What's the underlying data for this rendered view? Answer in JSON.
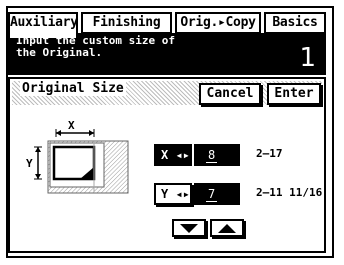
{
  "tabs": [
    {
      "label": "Auxiliary",
      "active": true
    },
    {
      "label": "Finishing",
      "active": false
    },
    {
      "label": "Orig.▸Copy",
      "active": false
    },
    {
      "label": "Basics",
      "active": false
    }
  ],
  "message": {
    "text": "Input the custom size of\nthe Original.",
    "count": "1"
  },
  "panel": {
    "title": "Original Size",
    "cancel_label": "Cancel",
    "enter_label": "Enter"
  },
  "diagram": {
    "x_label": "X",
    "y_label": "Y"
  },
  "size_rows": {
    "x": {
      "button_label": "X ◂▸",
      "value": "8",
      "range": "2–17",
      "selected": true
    },
    "y": {
      "button_label": "Y ◂▸",
      "value": "7",
      "range": "2–11 11/16",
      "selected": false
    }
  }
}
